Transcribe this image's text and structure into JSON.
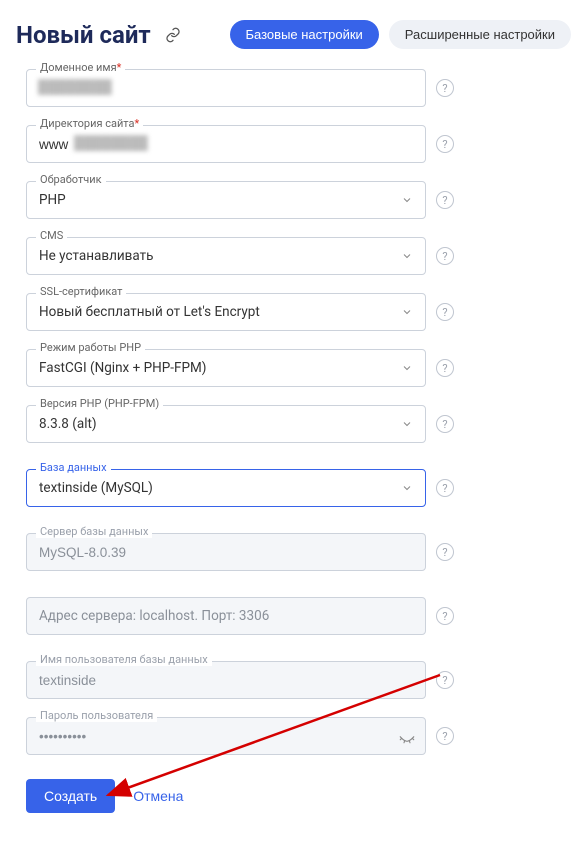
{
  "header": {
    "title": "Новый сайт",
    "tab_basic": "Базовые настройки",
    "tab_advanced": "Расширенные настройки"
  },
  "fields": {
    "domain": {
      "label": "Доменное имя",
      "value": ""
    },
    "directory": {
      "label": "Директория сайта",
      "value": "www"
    },
    "handler": {
      "label": "Обработчик",
      "value": "PHP"
    },
    "cms": {
      "label": "CMS",
      "value": "Не устанавливать"
    },
    "ssl": {
      "label": "SSL-сертификат",
      "value": "Новый бесплатный от Let's Encrypt"
    },
    "php_mode": {
      "label": "Режим работы PHP",
      "value": "FastCGI (Nginx + PHP-FPM)"
    },
    "php_version": {
      "label": "Версия PHP (PHP-FPM)",
      "value": "8.3.8 (alt)"
    },
    "database": {
      "label": "База данных",
      "value": "textinside (MySQL)"
    },
    "db_server": {
      "label": "Сервер базы данных",
      "value": "MySQL-8.0.39"
    },
    "db_address": {
      "placeholder": "Адрес сервера: localhost. Порт: 3306"
    },
    "db_user": {
      "label": "Имя пользователя базы данных",
      "value": "textinside"
    },
    "db_password": {
      "label": "Пароль пользователя",
      "value": "••••••••••"
    }
  },
  "actions": {
    "create": "Создать",
    "cancel": "Отмена"
  },
  "help": "?"
}
